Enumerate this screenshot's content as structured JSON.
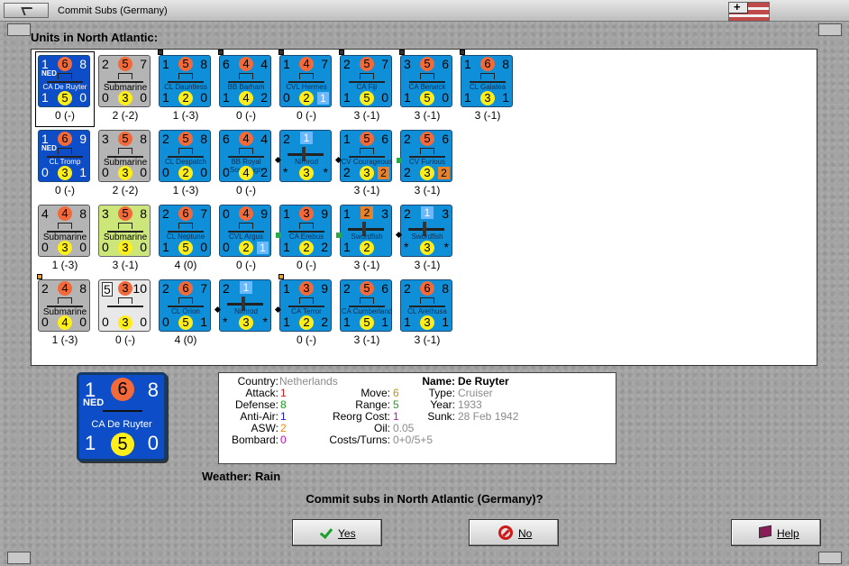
{
  "window": {
    "title": "Commit Subs (Germany)"
  },
  "section_label": "Units in North Atlantic:",
  "units": [
    {
      "row": 0,
      "col": 0,
      "style": "navy",
      "selected": true,
      "nat": "NED",
      "tl": "1",
      "tc": "6",
      "tr": "8",
      "name": "CA De Ruyter",
      "bl": "1",
      "bc": "5",
      "br": "0",
      "status": "0 (-)"
    },
    {
      "row": 0,
      "col": 1,
      "style": "gray",
      "tl": "2",
      "tc": "5",
      "tr": "7",
      "name": "Submarine",
      "bl": "0",
      "bc": "3",
      "br": "0",
      "status": "2 (-2)"
    },
    {
      "row": 0,
      "col": 2,
      "style": "blue",
      "tag": "dark",
      "tl": "1",
      "tc": "5",
      "tr": "8",
      "name": "CL Dauntless",
      "bl": "1",
      "bc": "2",
      "br": "0",
      "status": "1 (-3)"
    },
    {
      "row": 0,
      "col": 3,
      "style": "blue",
      "tag": "dark",
      "tl": "6",
      "tc": "4",
      "tr": "4",
      "name": "BB Barham",
      "bl": "1",
      "bc": "4",
      "br": "2",
      "status": "0 (-)"
    },
    {
      "row": 0,
      "col": 4,
      "style": "blue",
      "tag": "dark",
      "tl": "1",
      "tc": "4",
      "tr": "7",
      "name": "CVL Hermes",
      "bl": "0",
      "bc": "2",
      "br": "",
      "sq": "1",
      "status": "0 (-)"
    },
    {
      "row": 0,
      "col": 5,
      "style": "blue",
      "tag": "dark",
      "tl": "2",
      "tc": "5",
      "tr": "7",
      "name": "CA Fiji",
      "bl": "1",
      "bc": "5",
      "br": "0",
      "status": "3 (-1)"
    },
    {
      "row": 0,
      "col": 6,
      "style": "blue",
      "tag": "dark",
      "tl": "3",
      "tc": "5",
      "tr": "6",
      "name": "CA Berwick",
      "bl": "1",
      "bc": "5",
      "br": "0",
      "status": "3 (-1)"
    },
    {
      "row": 0,
      "col": 7,
      "style": "blue",
      "tag": "dark",
      "tl": "1",
      "tc": "6",
      "tr": "8",
      "name": "CL Galatea",
      "bl": "1",
      "bc": "3",
      "br": "1",
      "status": "3 (-1)"
    },
    {
      "row": 1,
      "col": 0,
      "style": "navy",
      "nat": "NED",
      "tl": "1",
      "tc": "6",
      "tr": "9",
      "name": "CL Tromp",
      "bl": "0",
      "bc": "3",
      "br": "1",
      "status": "0 (-)"
    },
    {
      "row": 1,
      "col": 1,
      "style": "gray",
      "tl": "3",
      "tc": "5",
      "tr": "8",
      "name": "Submarine",
      "bl": "0",
      "bc": "3",
      "br": "0",
      "status": "2 (-2)"
    },
    {
      "row": 1,
      "col": 2,
      "style": "blue",
      "tl": "2",
      "tc": "5",
      "tr": "8",
      "name": "CL Despatch",
      "bl": "0",
      "bc": "2",
      "br": "0",
      "status": "1 (-3)"
    },
    {
      "row": 1,
      "col": 3,
      "style": "blue",
      "tl": "6",
      "tc": "4",
      "tr": "4",
      "name": "BB Royal Sovereign",
      "bl": "0",
      "bc": "4",
      "br": "2",
      "status": "0 (-)"
    },
    {
      "row": 1,
      "col": 4,
      "style": "blue",
      "plane": true,
      "tl": "2",
      "tsq": "1",
      "tr": "",
      "name": "Nimrod",
      "bl": "*",
      "bc": "3",
      "br": "*",
      "status": ""
    },
    {
      "row": 1,
      "col": 5,
      "style": "blue",
      "tl": "1",
      "tc": "5",
      "tr": "6",
      "name": "CV Courageous",
      "bl": "2",
      "bc": "3",
      "br": "",
      "sq": "2",
      "sqorange": true,
      "status": "3 (-1)"
    },
    {
      "row": 1,
      "col": 6,
      "style": "blue",
      "tl": "2",
      "tc": "5",
      "tr": "6",
      "name": "CV Furious",
      "bl": "2",
      "bc": "3",
      "br": "",
      "sq": "2",
      "sqorange": true,
      "status": "3 (-1)"
    },
    {
      "row": 2,
      "col": 0,
      "style": "gray",
      "tl": "4",
      "tc": "4",
      "tr": "8",
      "name": "Submarine",
      "bl": "0",
      "bc": "3",
      "br": "0",
      "status": "1 (-3)"
    },
    {
      "row": 2,
      "col": 1,
      "style": "green",
      "tl": "3",
      "tc": "5",
      "tr": "8",
      "name": "Submarine",
      "bl": "0",
      "bc": "3",
      "br": "0",
      "status": "3 (-1)"
    },
    {
      "row": 2,
      "col": 2,
      "style": "blue",
      "tl": "2",
      "tc": "6",
      "tr": "7",
      "name": "CL Neptune",
      "bl": "1",
      "bc": "5",
      "br": "0",
      "status": "4 (0)"
    },
    {
      "row": 2,
      "col": 3,
      "style": "blue",
      "tl": "0",
      "tc": "4",
      "tr": "9",
      "name": "CVL Argus",
      "bl": "0",
      "bc": "2",
      "br": "",
      "sq": "1",
      "status": "0 (-)"
    },
    {
      "row": 2,
      "col": 4,
      "style": "blue",
      "tl": "1",
      "tc": "3",
      "tr": "9",
      "name": "CA Erebus",
      "bl": "1",
      "bc": "2",
      "br": "2",
      "status": "0 (-)"
    },
    {
      "row": 2,
      "col": 5,
      "style": "blue",
      "plane": true,
      "tl": "1",
      "tsq": "2",
      "tsqorange": true,
      "tr": "3",
      "name": "Swordfish",
      "bl": "1",
      "bc": "2",
      "br": "",
      "status": "3 (-1)"
    },
    {
      "row": 2,
      "col": 6,
      "style": "blue",
      "plane": true,
      "tl": "2",
      "tsq": "1",
      "tr": "3",
      "name": "Swordfish",
      "bl": "*",
      "bc": "3",
      "br": "*",
      "status": "3 (-1)"
    },
    {
      "row": 3,
      "col": 0,
      "style": "gray",
      "tag": "orange",
      "tl": "2",
      "tc": "4",
      "tr": "8",
      "name": "Submarine",
      "bl": "0",
      "bc": "4",
      "br": "0",
      "status": "1 (-3)"
    },
    {
      "row": 3,
      "col": 1,
      "style": "white",
      "tl": "5",
      "tc": "3",
      "tr": "10",
      "name": "",
      "bl": "0",
      "bc": "3",
      "br": "0",
      "status": "0 (-)"
    },
    {
      "row": 3,
      "col": 2,
      "style": "blue",
      "tl": "2",
      "tc": "6",
      "tr": "7",
      "name": "CL Orion",
      "bl": "0",
      "bc": "5",
      "br": "1",
      "status": "4 (0)"
    },
    {
      "row": 3,
      "col": 3,
      "style": "blue",
      "plane": true,
      "tl": "2",
      "tsq": "1",
      "tr": "",
      "name": "Nimrod",
      "bl": "*",
      "bc": "3",
      "br": "*",
      "status": ""
    },
    {
      "row": 3,
      "col": 4,
      "style": "blue",
      "tag": "orange",
      "tl": "1",
      "tc": "3",
      "tr": "9",
      "name": "CA Terror",
      "bl": "1",
      "bc": "2",
      "br": "2",
      "status": "0 (-)"
    },
    {
      "row": 3,
      "col": 5,
      "style": "blue",
      "tl": "2",
      "tc": "5",
      "tr": "6",
      "name": "CA Cumberland",
      "bl": "1",
      "bc": "5",
      "br": "1",
      "status": "3 (-1)"
    },
    {
      "row": 3,
      "col": 6,
      "style": "blue",
      "tl": "2",
      "tc": "6",
      "tr": "8",
      "name": "CL Arethusa",
      "bl": "1",
      "bc": "3",
      "br": "1",
      "status": "3 (-1)"
    }
  ],
  "selected_unit": {
    "nat": "NED",
    "tl": "1",
    "tc": "6",
    "tr": "8",
    "name": "CA De Ruyter",
    "bl": "1",
    "bc": "5",
    "br": "0"
  },
  "info": {
    "country_label": "Country:",
    "country": "Netherlands",
    "attack_label": "Attack:",
    "attack": "1",
    "defense_label": "Defense:",
    "defense": "8",
    "antiair_label": "Anti-Air:",
    "antiair": "1",
    "asw_label": "ASW:",
    "asw": "2",
    "bombard_label": "Bombard:",
    "bombard": "0",
    "move_label": "Move:",
    "move": "6",
    "range_label": "Range:",
    "range": "5",
    "reorg_label": "Reorg Cost:",
    "reorg": "1",
    "oil_label": "Oil:",
    "oil": "0.05",
    "costs_label": "Costs/Turns:",
    "costs": "0+0/5+5",
    "name_label": "Name:",
    "name": "De Ruyter",
    "type_label": "Type:",
    "type": "Cruiser",
    "year_label": "Year:",
    "year": "1933",
    "sunk_label": "Sunk:",
    "sunk": "28 Feb 1942"
  },
  "weather_text": "Weather: Rain",
  "question": "Commit subs in North Atlantic (Germany)?",
  "buttons": {
    "yes": "Yes",
    "no": "No",
    "help": "Help"
  },
  "colors": {
    "attack": "#d02020",
    "defense": "#1a9a1a",
    "antiair": "#1a1ad0",
    "asw": "#e08a1a",
    "bombard": "#c010c0",
    "move": "#c09010",
    "range": "#2a9a2a",
    "reorg": "#c010c0"
  }
}
